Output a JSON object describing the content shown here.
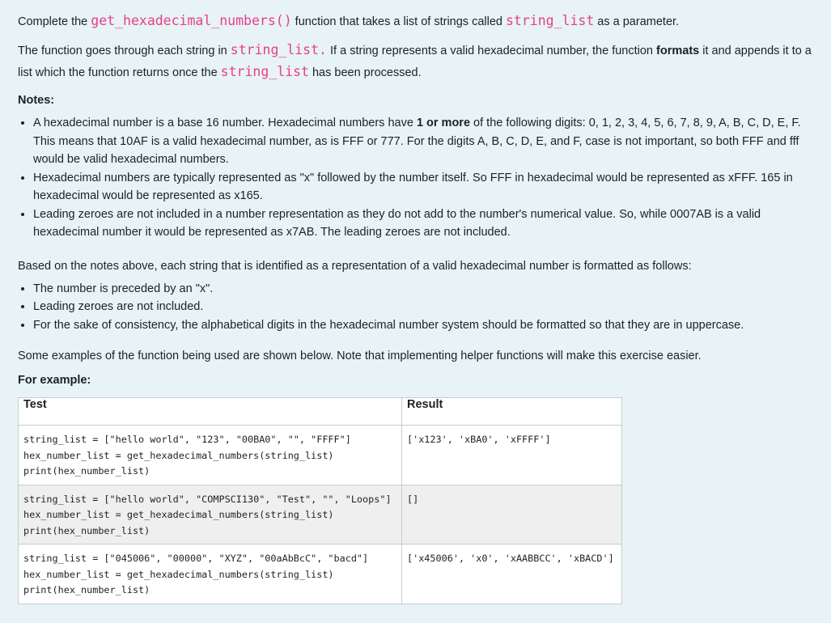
{
  "intro": {
    "p1_pre": "Complete the ",
    "func_name": "get_hexadecimal_numbers()",
    "p1_mid": " function that takes a list of strings called ",
    "param": "string_list",
    "p1_post": " as a parameter.",
    "p2_pre": "The function goes through each string in ",
    "param2": "string_list.",
    "p2_mid": " If a string represents a valid hexadecimal number, the function ",
    "formats": "formats",
    "p2_mid2": " it and appends it to a list which the function returns once the ",
    "param3": "string_list",
    "p2_post": " has been processed."
  },
  "notes": {
    "heading": "Notes:",
    "items": [
      {
        "pre": "A hexadecimal number is a base 16 number. Hexadecimal numbers have ",
        "bold": "1 or more",
        "post": " of the following digits: 0, 1, 2, 3, 4, 5, 6, 7, 8, 9, A, B, C, D, E, F. This means that 10AF is a valid hexadecimal number, as is FFF or 777. For the digits A, B, C, D, E, and F, case is not important, so both FFF and fff would be valid hexadecimal numbers."
      },
      {
        "text": "Hexadecimal numbers are typically represented as \"x\" followed by the number itself. So FFF in hexadecimal would be represented as xFFF. 165 in hexadecimal would be represented as x165."
      },
      {
        "text": "Leading zeroes are not included in a number representation as they do not add to the number's numerical value. So, while 0007AB is a valid hexadecimal number it would be represented as x7AB. The leading zeroes are not included."
      }
    ]
  },
  "format": {
    "intro": "Based on the notes above, each string that is identified as a representation of a valid hexadecimal number is formatted as follows:",
    "items": [
      "The number is preceded by an \"x\".",
      "Leading zeroes are not included.",
      "For the sake of consistency, the alphabetical digits in the hexadecimal number system should be formatted so that they are in uppercase."
    ]
  },
  "examples": {
    "intro": "Some examples of the function being used are shown below. Note that implementing helper functions will make this exercise easier.",
    "heading": "For example:",
    "table": {
      "headers": [
        "Test",
        "Result"
      ],
      "rows": [
        {
          "test": "string_list = [\"hello world\", \"123\", \"00BA0\", \"\", \"FFFF\"]\nhex_number_list = get_hexadecimal_numbers(string_list)\nprint(hex_number_list)",
          "result": "['x123', 'xBA0', 'xFFFF']"
        },
        {
          "test": "string_list = [\"hello world\", \"COMPSCI130\", \"Test\", \"\", \"Loops\"]\nhex_number_list = get_hexadecimal_numbers(string_list)\nprint(hex_number_list)",
          "result": "[]"
        },
        {
          "test": "string_list = [\"045006\", \"00000\", \"XYZ\", \"00aAbBcC\", \"bacd\"]\nhex_number_list = get_hexadecimal_numbers(string_list)\nprint(hex_number_list)",
          "result": "['x45006', 'x0', 'xAABBCC', 'xBACD']"
        }
      ]
    }
  },
  "colors": {
    "background": "#e7f3f5",
    "code": "#e83e8c",
    "alt_row": "#efefef",
    "text": "#1d2125"
  }
}
